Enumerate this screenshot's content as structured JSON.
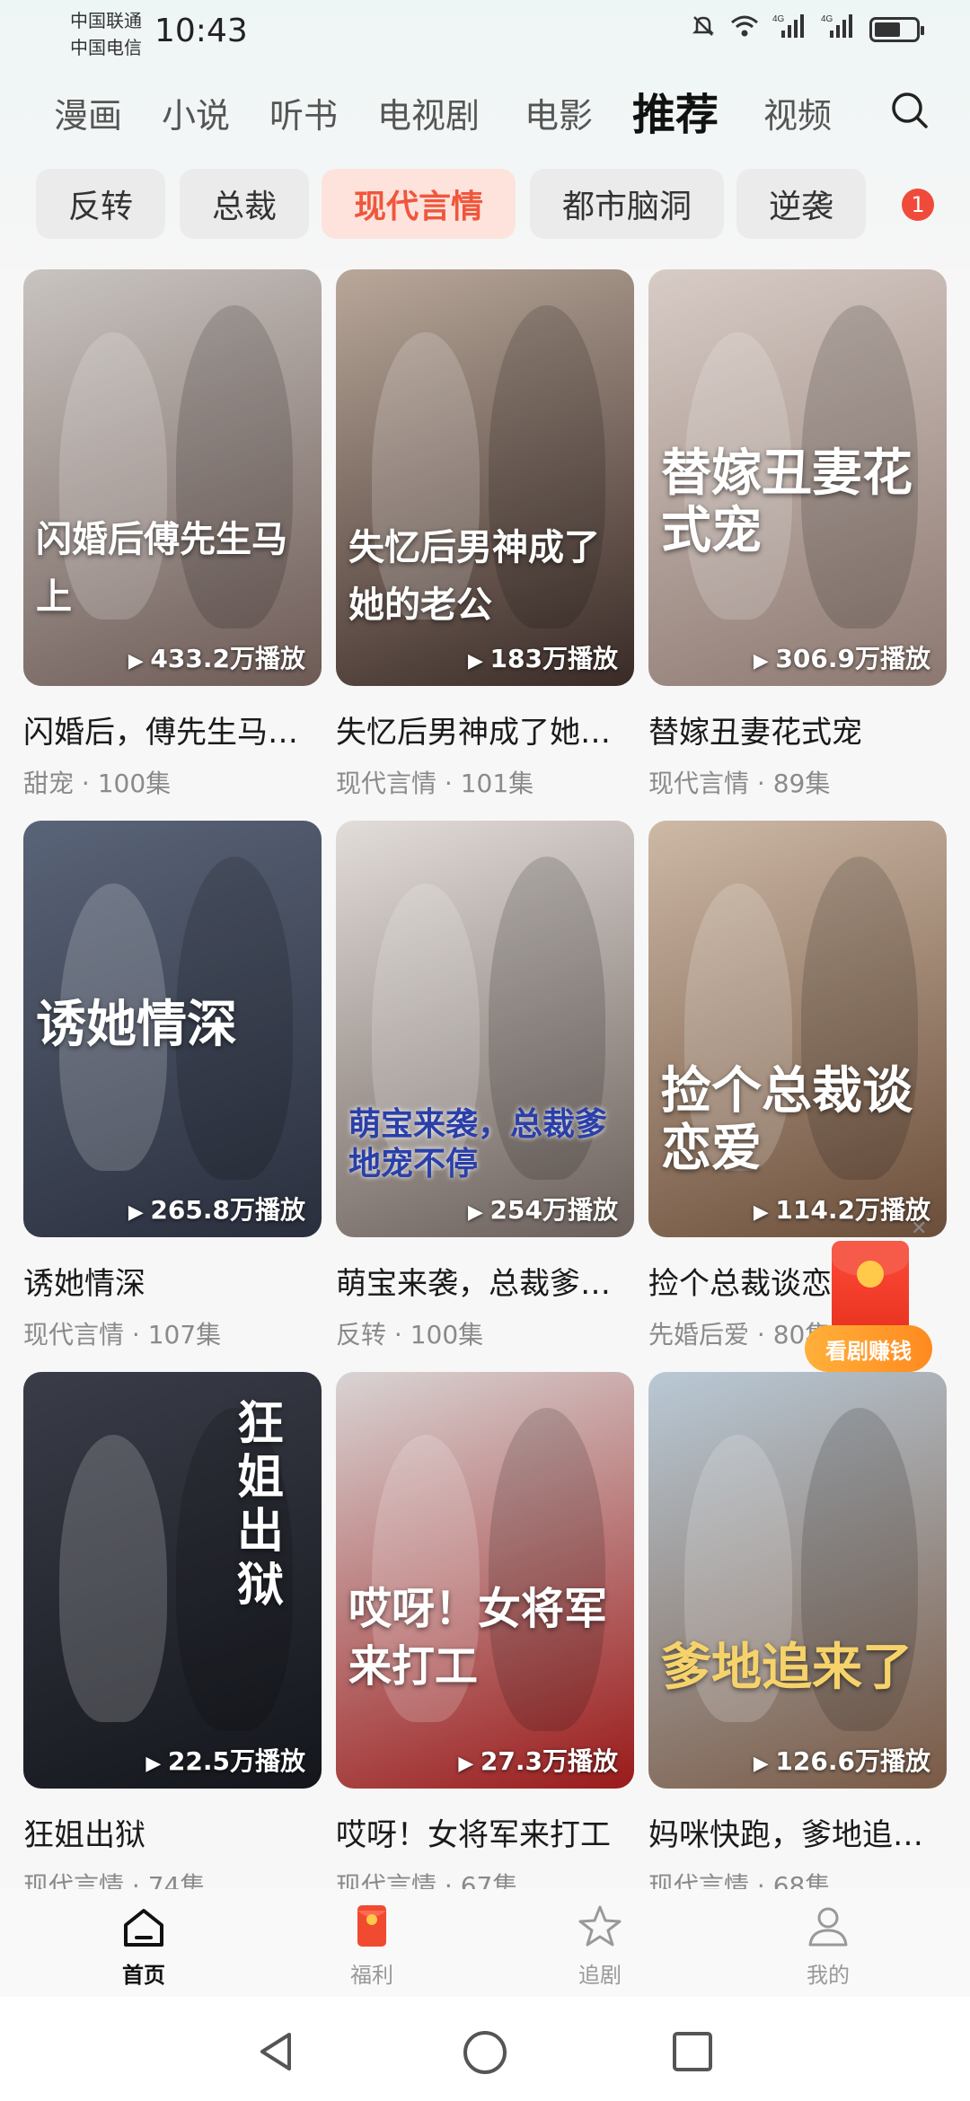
{
  "status_bar": {
    "carrier_1": "中国联通",
    "carrier_2": "中国电信",
    "time": "10:43"
  },
  "categories": [
    {
      "label": "漫画"
    },
    {
      "label": "小说"
    },
    {
      "label": "听书"
    },
    {
      "label": "电视剧"
    },
    {
      "label": "电影"
    },
    {
      "label": "推荐",
      "active": true
    },
    {
      "label": "视频"
    }
  ],
  "genres": [
    {
      "label": "反转"
    },
    {
      "label": "总裁"
    },
    {
      "label": "现代言情",
      "active": true
    },
    {
      "label": "都市脑洞"
    },
    {
      "label": "逆袭"
    }
  ],
  "notification_badge": "1",
  "cards": [
    {
      "title": "闪婚后，傅先生马上要离婚",
      "tag": "甜宠",
      "episodes": "100集",
      "plays": "433.2万播放",
      "poster_text": "闪婚后傅先生马上",
      "colors": [
        "#c9c4c0",
        "#6d5a55"
      ]
    },
    {
      "title": "失忆后男神成了她的老公",
      "tag": "现代言情",
      "episodes": "101集",
      "plays": "183万播放",
      "poster_text": "失忆后男神成了她的老公",
      "colors": [
        "#b9a89a",
        "#3a2a26"
      ]
    },
    {
      "title": "替嫁丑妻花式宠",
      "tag": "现代言情",
      "episodes": "89集",
      "plays": "306.9万播放",
      "poster_text": "替嫁丑妻花式宠",
      "colors": [
        "#d8ccc6",
        "#8c7870"
      ]
    },
    {
      "title": "诱她情深",
      "tag": "现代言情",
      "episodes": "107集",
      "plays": "265.8万播放",
      "poster_text": "诱她情深",
      "colors": [
        "#5a6478",
        "#2a2f3d"
      ]
    },
    {
      "title": "萌宝来袭，总裁爹地宠不停",
      "tag": "反转",
      "episodes": "100集",
      "plays": "254万播放",
      "poster_text": "萌宝来袭，总裁爹地宠不停",
      "colors": [
        "#e3ddd9",
        "#6a5f5a"
      ]
    },
    {
      "title": "捡个总裁谈恋爱",
      "tag": "先婚后爱",
      "episodes": "80集",
      "plays": "114.2万播放",
      "poster_text": "捡个总裁谈恋爱",
      "colors": [
        "#cdb9a6",
        "#6b4e3a"
      ]
    },
    {
      "title": "狂姐出狱",
      "tag": "现代言情",
      "episodes": "74集",
      "plays": "22.5万播放",
      "poster_text": "狂姐出狱",
      "colors": [
        "#3a3d48",
        "#14161c"
      ]
    },
    {
      "title": "哎呀！女将军来打工",
      "tag": "现代言情",
      "episodes": "67集",
      "plays": "27.3万播放",
      "poster_text": "哎呀！女将军来打工",
      "colors": [
        "#d9d4d4",
        "#9a1a1a"
      ]
    },
    {
      "title": "妈咪快跑，爹地追来了",
      "tag": "现代言情",
      "episodes": "68集",
      "plays": "126.6万播放",
      "poster_text": "爹地追来了",
      "colors": [
        "#b9c9d6",
        "#7a5a45"
      ]
    }
  ],
  "float_reward": {
    "label": "看剧赚钱"
  },
  "bottom_nav": [
    {
      "label": "首页",
      "icon": "home-icon",
      "active": true
    },
    {
      "label": "福利",
      "icon": "red-envelope-icon"
    },
    {
      "label": "追剧",
      "icon": "star-icon"
    },
    {
      "label": "我的",
      "icon": "person-icon"
    }
  ],
  "accent_color": "#f0563c"
}
